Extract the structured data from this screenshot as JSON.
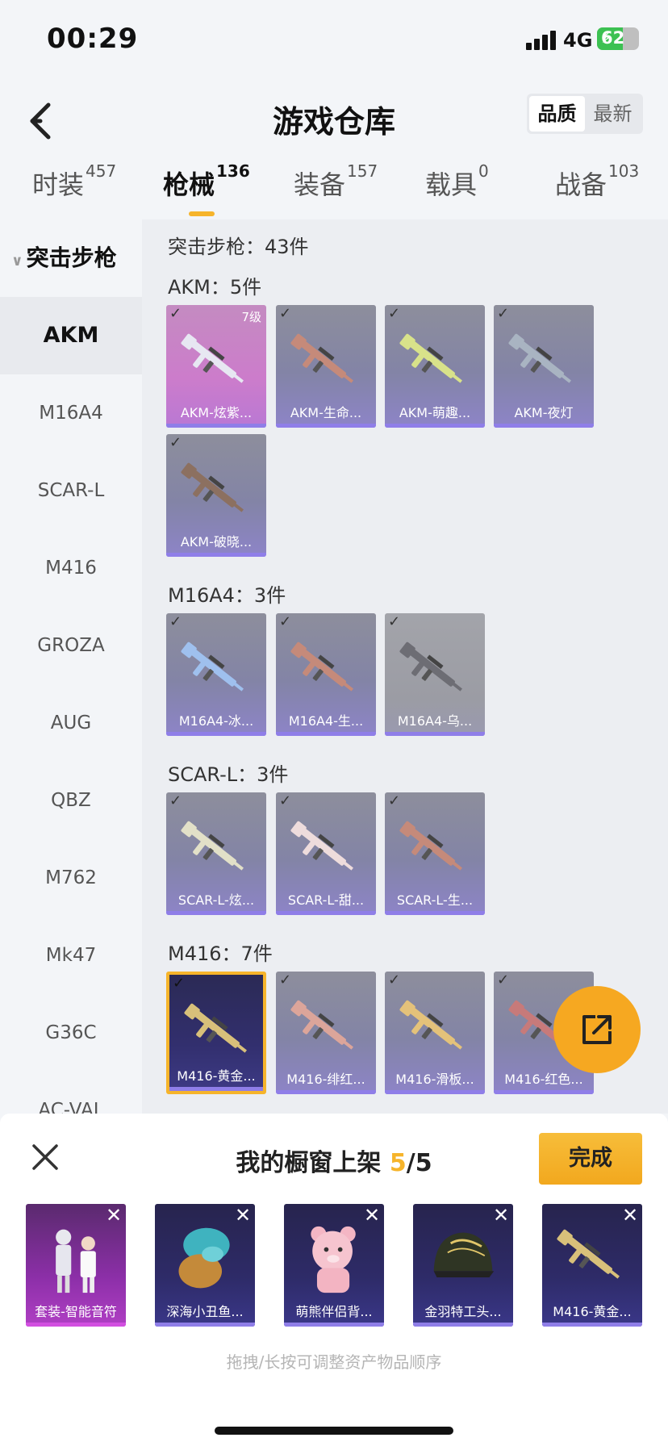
{
  "status_bar": {
    "time": "00:29",
    "network": "4G",
    "battery": "62",
    "battery_level": 0.62
  },
  "header": {
    "title": "游戏仓库",
    "sort_options": [
      "品质",
      "最新"
    ],
    "active_sort": 0
  },
  "tabs": [
    {
      "label": "时装",
      "count": "457"
    },
    {
      "label": "枪械",
      "count": "136"
    },
    {
      "label": "装备",
      "count": "157"
    },
    {
      "label": "载具",
      "count": "0"
    },
    {
      "label": "战备",
      "count": "103"
    }
  ],
  "sidebar": {
    "group": "突击步枪",
    "items": [
      "AKM",
      "M16A4",
      "SCAR-L",
      "M416",
      "GROZA",
      "AUG",
      "QBZ",
      "M762",
      "Mk47",
      "G36C",
      "AC-VAL"
    ]
  },
  "main": {
    "category_total": "突击步枪：43件",
    "sections": [
      {
        "title": "AKM：5件",
        "items": [
          {
            "name": "AKM-炫紫...",
            "level": "7级",
            "style": "pink",
            "gun_color": "#e7e7f2"
          },
          {
            "name": "AKM-生命...",
            "style": "normal",
            "gun_color": "#c58a7a"
          },
          {
            "name": "AKM-萌趣...",
            "style": "normal",
            "gun_color": "#d8e28a"
          },
          {
            "name": "AKM-夜灯",
            "style": "normal",
            "gun_color": "#a9b4c2"
          },
          {
            "name": "AKM-破晓...",
            "style": "normal",
            "gun_color": "#8c7060"
          }
        ]
      },
      {
        "title": "M16A4：3件",
        "items": [
          {
            "name": "M16A4-冰...",
            "style": "normal",
            "gun_color": "#9fc0ee"
          },
          {
            "name": "M16A4-生...",
            "style": "normal",
            "gun_color": "#c58a7a"
          },
          {
            "name": "M16A4-乌...",
            "style": "grey",
            "gun_color": "#6d6d74"
          }
        ]
      },
      {
        "title": "SCAR-L：3件",
        "items": [
          {
            "name": "SCAR-L-炫...",
            "style": "normal",
            "gun_color": "#e2e0c8"
          },
          {
            "name": "SCAR-L-甜...",
            "style": "normal",
            "gun_color": "#eedcdc"
          },
          {
            "name": "SCAR-L-生...",
            "style": "normal",
            "gun_color": "#c58a7a"
          }
        ]
      },
      {
        "title": "M416：7件",
        "items": [
          {
            "name": "M416-黄金...",
            "style": "gold",
            "gun_color": "#d8c07a"
          },
          {
            "name": "M416-绯红...",
            "style": "normal",
            "gun_color": "#dca59a"
          },
          {
            "name": "M416-滑板...",
            "style": "normal",
            "gun_color": "#e4c27a"
          },
          {
            "name": "M416-红色...",
            "style": "normal",
            "gun_color": "#c77a7a"
          }
        ]
      }
    ]
  },
  "sheet": {
    "title_prefix": "我的橱窗上架",
    "current": "5",
    "separator": "/",
    "total": "5",
    "done_label": "完成",
    "close_symbol": "✕",
    "slots": [
      {
        "name": "套装-智能音符",
        "style": "purple",
        "icon": "outfit-icon"
      },
      {
        "name": "深海小丑鱼...",
        "style": "blue",
        "icon": "hair-icon"
      },
      {
        "name": "萌熊伴侣背...",
        "style": "blue",
        "icon": "bear-backpack-icon"
      },
      {
        "name": "金羽特工头...",
        "style": "blue",
        "icon": "helmet-icon"
      },
      {
        "name": "M416-黄金...",
        "style": "blue",
        "icon": "rifle-icon"
      }
    ],
    "hint": "拖拽/长按可调整资产物品顺序"
  },
  "colors": {
    "accent": "#f6b42b",
    "fab": "#f6a821",
    "card_bar": "#8f7ee8"
  }
}
